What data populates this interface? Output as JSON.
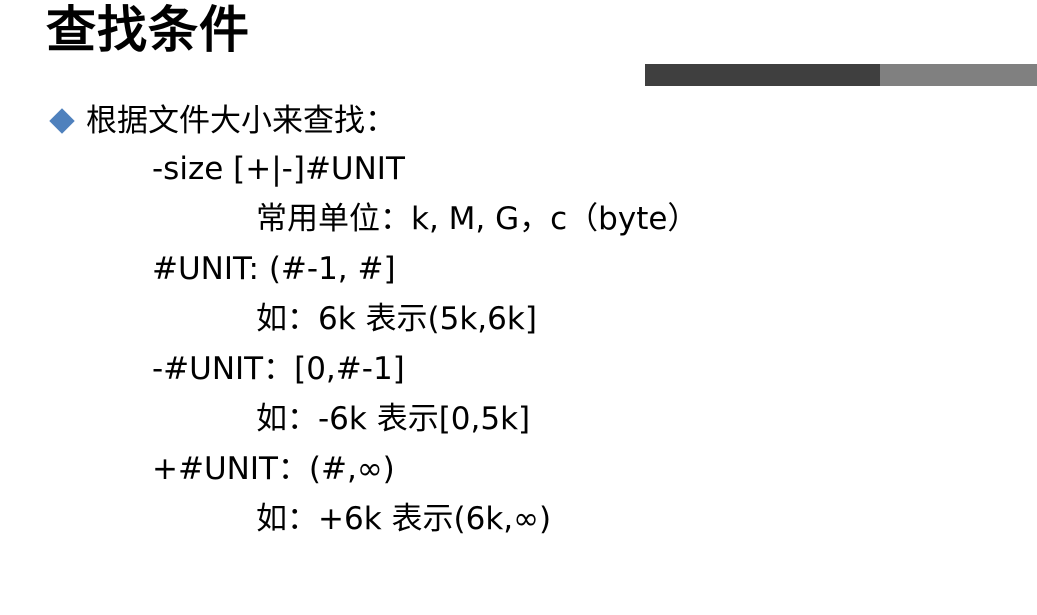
{
  "slide": {
    "title": "查找条件",
    "bullet": "根据文件大小来查找：",
    "lines": [
      "-size [+|-]#UNIT",
      "常用单位：k, M, G，c（byte）",
      "#UNIT: (#-1, #]",
      "如：6k 表示(5k,6k]",
      "-#UNIT：[0,#-1]",
      "如：-6k 表示[0,5k]",
      "+#UNIT：(#,∞)",
      "如：+6k 表示(6k,∞)"
    ]
  },
  "colors": {
    "bullet_diamond": "#4f81bd",
    "bar_dark": "#3f3f3f",
    "bar_light": "#808080"
  },
  "icons": {
    "bullet": "diamond-bullet-icon"
  }
}
